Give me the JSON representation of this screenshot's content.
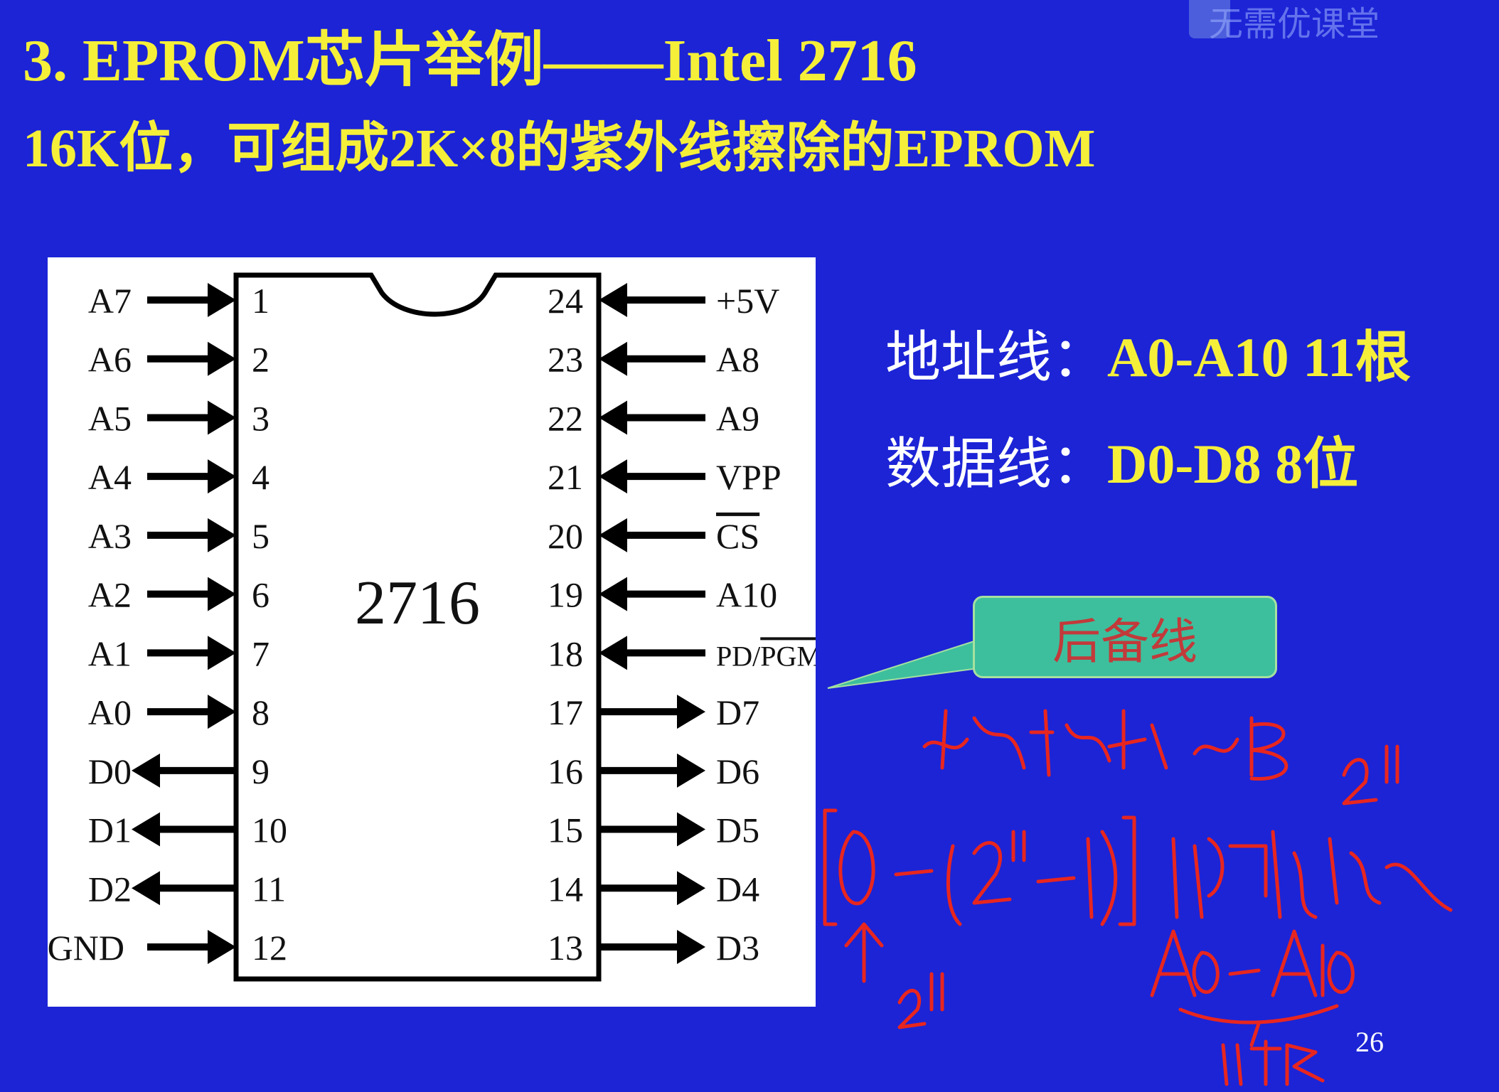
{
  "slide": {
    "title": "3. EPROM芯片举例——Intel 2716",
    "subtitle": "16K位，可组成2K×8的紫外线擦除的EPROM",
    "watermark": "无需优课堂",
    "page_number": "26"
  },
  "chip": {
    "label": "2716",
    "left_pins": [
      {
        "num": "1",
        "name": "A7",
        "dir": "in"
      },
      {
        "num": "2",
        "name": "A6",
        "dir": "in"
      },
      {
        "num": "3",
        "name": "A5",
        "dir": "in"
      },
      {
        "num": "4",
        "name": "A4",
        "dir": "in"
      },
      {
        "num": "5",
        "name": "A3",
        "dir": "in"
      },
      {
        "num": "6",
        "name": "A2",
        "dir": "in"
      },
      {
        "num": "7",
        "name": "A1",
        "dir": "in"
      },
      {
        "num": "8",
        "name": "A0",
        "dir": "in"
      },
      {
        "num": "9",
        "name": "D0",
        "dir": "out"
      },
      {
        "num": "10",
        "name": "D1",
        "dir": "out"
      },
      {
        "num": "11",
        "name": "D2",
        "dir": "out"
      },
      {
        "num": "12",
        "name": "GND",
        "dir": "in"
      }
    ],
    "right_pins": [
      {
        "num": "24",
        "name": "+5V",
        "dir": "in"
      },
      {
        "num": "23",
        "name": "A8",
        "dir": "in"
      },
      {
        "num": "22",
        "name": "A9",
        "dir": "in"
      },
      {
        "num": "21",
        "name": "VPP",
        "dir": "in"
      },
      {
        "num": "20",
        "name": "CS",
        "dir": "in",
        "overline": true
      },
      {
        "num": "19",
        "name": "A10",
        "dir": "in"
      },
      {
        "num": "18",
        "name": "PD/PGM",
        "dir": "in",
        "overline_part": "PGM"
      },
      {
        "num": "17",
        "name": "D7",
        "dir": "out"
      },
      {
        "num": "16",
        "name": "D6",
        "dir": "out"
      },
      {
        "num": "15",
        "name": "D5",
        "dir": "out"
      },
      {
        "num": "14",
        "name": "D4",
        "dir": "out"
      },
      {
        "num": "13",
        "name": "D3",
        "dir": "out"
      }
    ]
  },
  "info": {
    "address_label": "地址线：",
    "address_value": "A0-A10  11根",
    "data_label": "数据线：",
    "data_value": "D0-D8  8位"
  },
  "callout": {
    "text": "后备线"
  },
  "colors": {
    "background": "#1c24d6",
    "title": "#f5ef3a",
    "callout_fill": "#3dbf9d",
    "callout_text": "#c23a3a",
    "ink": "#e8261f"
  }
}
